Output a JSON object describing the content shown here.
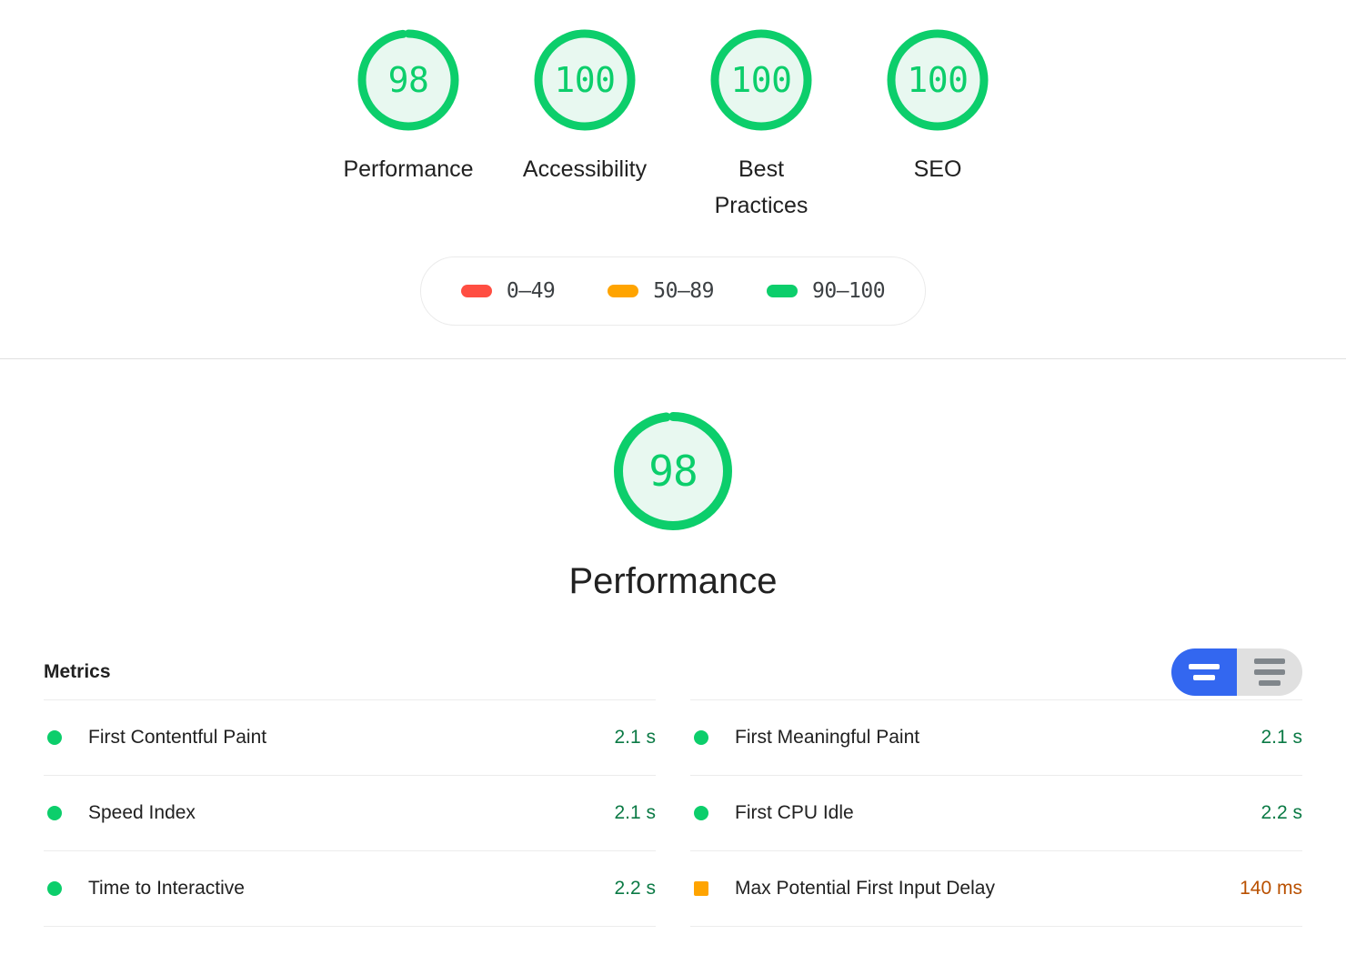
{
  "colors": {
    "pass": "#0CCE6B",
    "average": "#FFA400",
    "fail": "#FF4E42",
    "pass_text": "#0B7A45",
    "average_text": "#B95000",
    "gauge_fill": "#E8F8F0",
    "toggle_active": "#3367F0",
    "toggle_inactive": "#E0E0E0"
  },
  "scores": {
    "gauges": [
      {
        "value": "98",
        "score": 98,
        "label": "Performance",
        "rating": "pass"
      },
      {
        "value": "100",
        "score": 100,
        "label": "Accessibility",
        "rating": "pass"
      },
      {
        "value": "100",
        "score": 100,
        "label": "Best Practices",
        "rating": "pass"
      },
      {
        "value": "100",
        "score": 100,
        "label": "SEO",
        "rating": "pass"
      }
    ]
  },
  "legend": {
    "items": [
      {
        "range": "0–49",
        "color": "#FF4E42",
        "rating": "fail"
      },
      {
        "range": "50–89",
        "color": "#FFA400",
        "rating": "average"
      },
      {
        "range": "90–100",
        "color": "#0CCE6B",
        "rating": "pass"
      }
    ]
  },
  "category": {
    "gauge_value": "98",
    "gauge_score": 98,
    "title": "Performance",
    "rating": "pass"
  },
  "metrics": {
    "title": "Metrics",
    "toggle": {
      "simple_label": "simple-view",
      "detail_label": "detail-view",
      "selected": "simple-view"
    },
    "left_column": [
      {
        "name": "First Contentful Paint",
        "value": "2.1 s",
        "rating": "pass"
      },
      {
        "name": "Speed Index",
        "value": "2.1 s",
        "rating": "pass"
      },
      {
        "name": "Time to Interactive",
        "value": "2.2 s",
        "rating": "pass"
      }
    ],
    "right_column": [
      {
        "name": "First Meaningful Paint",
        "value": "2.1 s",
        "rating": "pass"
      },
      {
        "name": "First CPU Idle",
        "value": "2.2 s",
        "rating": "pass"
      },
      {
        "name": "Max Potential First Input Delay",
        "value": "140 ms",
        "rating": "average"
      }
    ]
  },
  "chart_data": {
    "type": "table",
    "title": "Lighthouse Performance Metrics",
    "categories": [
      "First Contentful Paint",
      "Speed Index",
      "Time to Interactive",
      "First Meaningful Paint",
      "First CPU Idle",
      "Max Potential First Input Delay"
    ],
    "values": [
      2.1,
      2.1,
      2.2,
      2.1,
      2.2,
      140
    ],
    "units": [
      "s",
      "s",
      "s",
      "s",
      "s",
      "ms"
    ],
    "ratings": [
      "pass",
      "pass",
      "pass",
      "pass",
      "pass",
      "average"
    ],
    "scores": {
      "categories": [
        "Performance",
        "Accessibility",
        "Best Practices",
        "SEO"
      ],
      "values": [
        98,
        100,
        100,
        100
      ],
      "ylim": [
        0,
        100
      ]
    },
    "legend_position": "top-center",
    "grid": false
  }
}
